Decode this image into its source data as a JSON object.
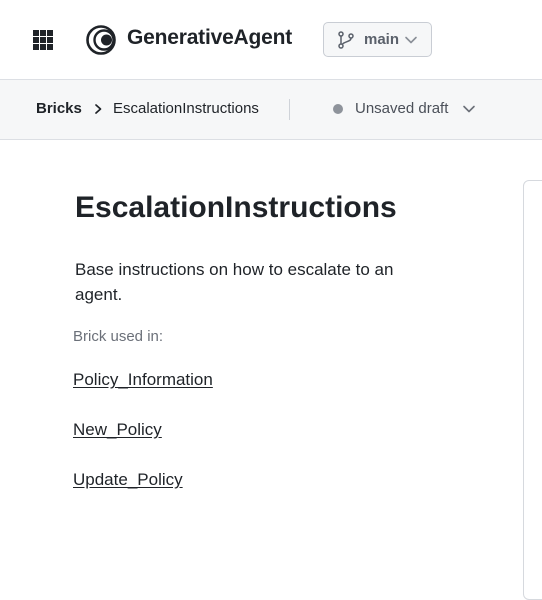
{
  "header": {
    "apps_icon": "grid-apps-icon",
    "logo_icon": "generativeagent-logo-icon",
    "app_title": "GenerativeAgent",
    "branch": {
      "icon": "git-branch-icon",
      "label": "main",
      "chevron": "chevron-down-icon"
    }
  },
  "breadcrumb": {
    "root": "Bricks",
    "separator_icon": "chevron-right-icon",
    "current": "EscalationInstructions",
    "status": {
      "dot_color": "#8e939b",
      "label": "Unsaved draft",
      "chevron": "chevron-down-icon"
    }
  },
  "main": {
    "title": "EscalationInstructions",
    "description": "Base instructions on how to escalate to an agent.",
    "used_in_label": "Brick used in:",
    "used_in": [
      {
        "label": "Policy_Information"
      },
      {
        "label": "New_Policy"
      },
      {
        "label": "Update_Policy"
      }
    ]
  },
  "colors": {
    "text": "#1f2328",
    "muted": "#6b7079",
    "border": "#dcdfe4",
    "bar_bg": "#f6f7f8"
  }
}
